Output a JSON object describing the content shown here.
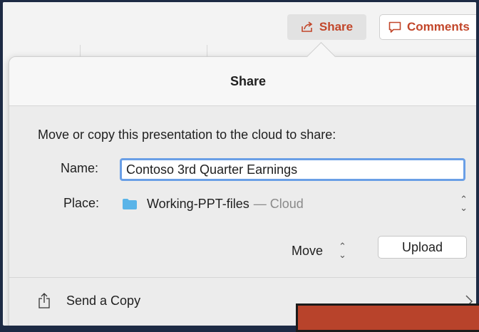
{
  "toolbar": {
    "share_label": "Share",
    "comments_label": "Comments",
    "accent_color": "#c2462a"
  },
  "dialog": {
    "title": "Share",
    "instruction": "Move or copy this presentation to the cloud to share:",
    "name_label": "Name:",
    "name_value": "Contoso 3rd Quarter Earnings",
    "place_label": "Place:",
    "place_folder": "Working-PPT-files",
    "place_location": "— Cloud",
    "action_value": "Move",
    "upload_label": "Upload",
    "send_copy_label": "Send a Copy"
  }
}
